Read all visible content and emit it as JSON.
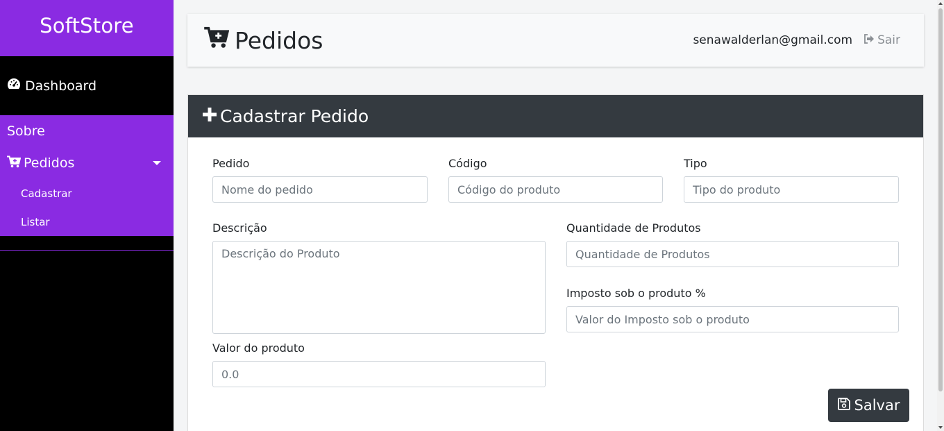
{
  "sidebar": {
    "brand": "SoftStore",
    "dashboard_label": "Dashboard",
    "sobre_label": "Sobre",
    "pedidos_label": "Pedidos",
    "sub_items": [
      "Cadastrar",
      "Listar"
    ]
  },
  "header": {
    "title": "Pedidos",
    "user_email": "senawalderlan@gmail.com",
    "logout_label": "Sair"
  },
  "form": {
    "title": "Cadastrar Pedido",
    "pedido": {
      "label": "Pedido",
      "placeholder": "Nome do pedido"
    },
    "codigo": {
      "label": "Código",
      "placeholder": "Código do produto"
    },
    "tipo": {
      "label": "Tipo",
      "placeholder": "Tipo do produto"
    },
    "descricao": {
      "label": "Descrição",
      "placeholder": "Descrição do Produto"
    },
    "quantidade": {
      "label": "Quantidade de Produtos",
      "placeholder": "Quantidade de Produtos"
    },
    "imposto": {
      "label": "Imposto sob o produto %",
      "placeholder": "Valor do Imposto sob o produto"
    },
    "valor": {
      "label": "Valor do produto",
      "placeholder": "0.0"
    },
    "save_label": "Salvar"
  },
  "colors": {
    "brand_purple": "#8a2be2",
    "sidebar_black": "#000000",
    "card_header": "#343a40"
  },
  "icons": {
    "dashboard": "tachometer-icon",
    "pedidos": "cart-plus-icon",
    "logout": "sign-out-icon",
    "add": "plus-icon",
    "save": "floppy-disk-icon"
  }
}
